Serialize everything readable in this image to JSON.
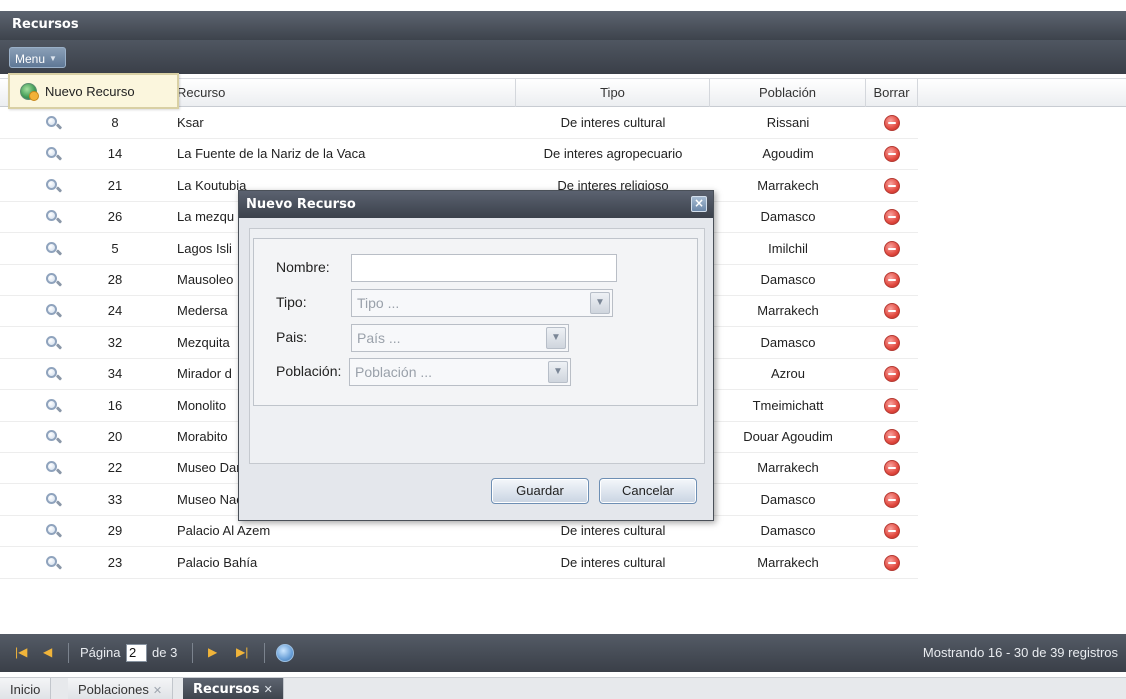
{
  "window": {
    "title": "Recursos"
  },
  "toolbar": {
    "menu_label": "Menu"
  },
  "menu_dropdown": {
    "items": [
      {
        "label": "Nuevo Recurso",
        "icon": "globe-add-icon"
      }
    ]
  },
  "grid": {
    "columns": {
      "recurso": "Recurso",
      "tipo": "Tipo",
      "poblacion": "Población",
      "borrar": "Borrar"
    },
    "rows": [
      {
        "id": "8",
        "recurso": "Ksar",
        "tipo": "De interes cultural",
        "poblacion": "Rissani"
      },
      {
        "id": "14",
        "recurso": "La Fuente de la Nariz de la Vaca",
        "tipo": "De interes agropecuario",
        "poblacion": "Agoudim"
      },
      {
        "id": "21",
        "recurso": "La Koutubia",
        "tipo": "De interes religioso",
        "poblacion": "Marrakech"
      },
      {
        "id": "26",
        "recurso": "La mezqu",
        "tipo": "",
        "poblacion": "Damasco"
      },
      {
        "id": "5",
        "recurso": "Lagos Isli",
        "tipo": "",
        "poblacion": "Imilchil"
      },
      {
        "id": "28",
        "recurso": "Mausoleo",
        "tipo": "",
        "poblacion": "Damasco"
      },
      {
        "id": "24",
        "recurso": "Medersa",
        "tipo": "",
        "poblacion": "Marrakech"
      },
      {
        "id": "32",
        "recurso": "Mezquita",
        "tipo": "",
        "poblacion": "Damasco"
      },
      {
        "id": "34",
        "recurso": "Mirador d",
        "tipo": "",
        "poblacion": "Azrou"
      },
      {
        "id": "16",
        "recurso": "Monolito",
        "tipo": "",
        "poblacion": "Tmeimichatt"
      },
      {
        "id": "20",
        "recurso": "Morabito",
        "tipo": "",
        "poblacion": "Douar Agoudim"
      },
      {
        "id": "22",
        "recurso": "Museo Dar Si Said",
        "tipo": "De interes cultural",
        "poblacion": "Marrakech"
      },
      {
        "id": "33",
        "recurso": "Museo Nacional",
        "tipo": "De interes cultural",
        "poblacion": "Damasco"
      },
      {
        "id": "29",
        "recurso": "Palacio Al Azem",
        "tipo": "De interes cultural",
        "poblacion": "Damasco"
      },
      {
        "id": "23",
        "recurso": "Palacio Bahía",
        "tipo": "De interes cultural",
        "poblacion": "Marrakech"
      }
    ]
  },
  "modal": {
    "title": "Nuevo Recurso",
    "fields": {
      "nombre_label": "Nombre:",
      "nombre_value": "",
      "tipo_label": "Tipo:",
      "tipo_placeholder": "Tipo ...",
      "pais_label": "Pais:",
      "pais_placeholder": "País ...",
      "poblacion_label": "Población:",
      "poblacion_placeholder": "Población ..."
    },
    "buttons": {
      "save": "Guardar",
      "cancel": "Cancelar"
    }
  },
  "paging": {
    "page_label": "Página",
    "current_page": "2",
    "of_label": "de 3",
    "status": "Mostrando 16 - 30 de 39 registros"
  },
  "tabs": [
    {
      "label": "Inicio",
      "closable": false
    },
    {
      "label": "Poblaciones",
      "closable": true
    },
    {
      "label": "Recursos",
      "closable": true,
      "active": true
    }
  ],
  "colors": {
    "header_dark": "#3d434c",
    "menu_button": "#6f88a6",
    "dropdown_bg": "#fbf6dd",
    "paging_accent": "#f0b43a",
    "delete_red": "#e24a40"
  }
}
